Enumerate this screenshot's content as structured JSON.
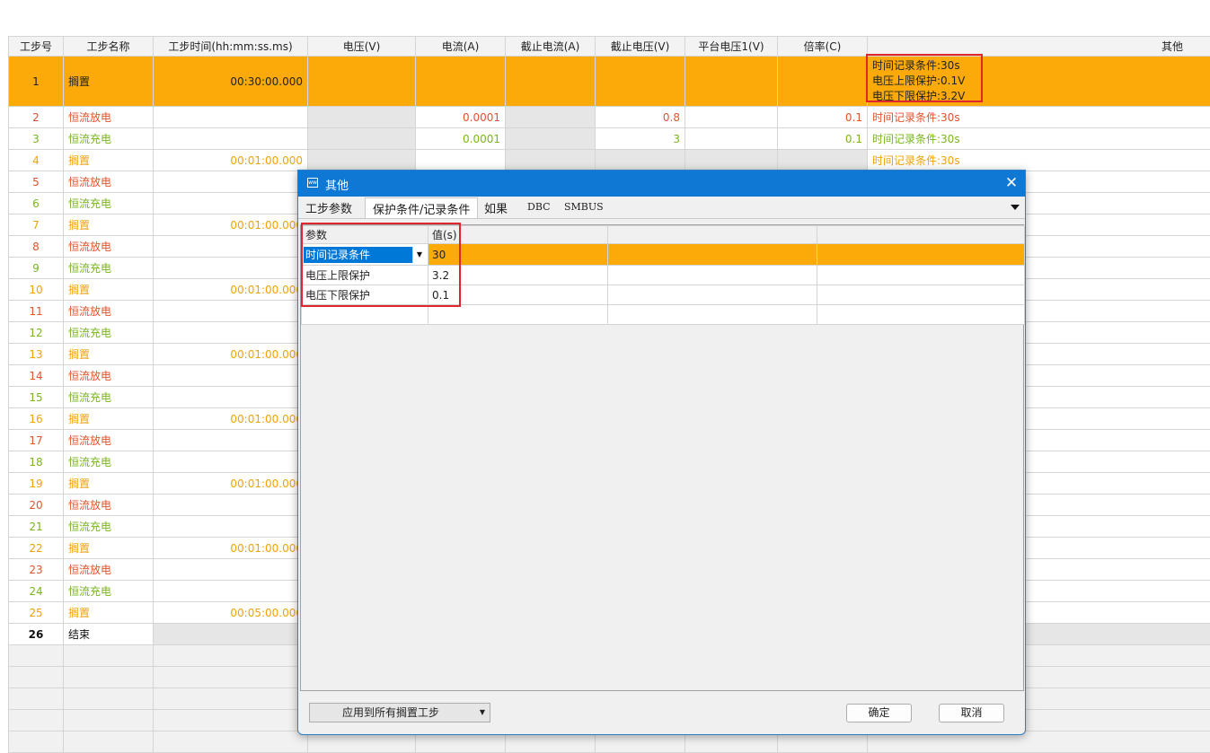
{
  "headers": [
    "工步号",
    "工步名称",
    "工步时间(hh:mm:ss.ms)",
    "电压(V)",
    "电流(A)",
    "截止电流(A)",
    "截止电压(V)",
    "平台电压1(V)",
    "倍率(C)",
    "其他"
  ],
  "steps": [
    {
      "no": "1",
      "name": "搁置",
      "time": "00:30:00.000",
      "voltage": "",
      "current": "",
      "cut_current": "",
      "cut_voltage": "",
      "plat_voltage": "",
      "rate": "",
      "other": [
        "时间记录条件:30s",
        "电压上限保护:0.1V",
        "电压下限保护:3.2V"
      ]
    },
    {
      "no": "2",
      "name": "恒流放电",
      "time": "",
      "voltage": "",
      "current": "0.0001",
      "cut_current": "",
      "cut_voltage": "0.8",
      "plat_voltage": "",
      "rate": "0.1",
      "other": [
        "时间记录条件:30s"
      ]
    },
    {
      "no": "3",
      "name": "恒流充电",
      "time": "",
      "voltage": "",
      "current": "0.0001",
      "cut_current": "",
      "cut_voltage": "3",
      "plat_voltage": "",
      "rate": "0.1",
      "other": [
        "时间记录条件:30s"
      ]
    },
    {
      "no": "4",
      "name": "搁置",
      "time": "00:01:00.000",
      "voltage": "",
      "current": "",
      "cut_current": "",
      "cut_voltage": "",
      "plat_voltage": "",
      "rate": "",
      "other": [
        "时间记录条件:30s"
      ]
    },
    {
      "no": "5",
      "name": "恒流放电",
      "time": ""
    },
    {
      "no": "6",
      "name": "恒流充电",
      "time": ""
    },
    {
      "no": "7",
      "name": "搁置",
      "time": "00:01:00.000"
    },
    {
      "no": "8",
      "name": "恒流放电",
      "time": ""
    },
    {
      "no": "9",
      "name": "恒流充电",
      "time": ""
    },
    {
      "no": "10",
      "name": "搁置",
      "time": "00:01:00.000"
    },
    {
      "no": "11",
      "name": "恒流放电",
      "time": ""
    },
    {
      "no": "12",
      "name": "恒流充电",
      "time": ""
    },
    {
      "no": "13",
      "name": "搁置",
      "time": "00:01:00.000"
    },
    {
      "no": "14",
      "name": "恒流放电",
      "time": ""
    },
    {
      "no": "15",
      "name": "恒流充电",
      "time": ""
    },
    {
      "no": "16",
      "name": "搁置",
      "time": "00:01:00.000"
    },
    {
      "no": "17",
      "name": "恒流放电",
      "time": ""
    },
    {
      "no": "18",
      "name": "恒流充电",
      "time": ""
    },
    {
      "no": "19",
      "name": "搁置",
      "time": "00:01:00.000"
    },
    {
      "no": "20",
      "name": "恒流放电",
      "time": ""
    },
    {
      "no": "21",
      "name": "恒流充电",
      "time": ""
    },
    {
      "no": "22",
      "name": "搁置",
      "time": "00:01:00.000"
    },
    {
      "no": "23",
      "name": "恒流放电",
      "time": ""
    },
    {
      "no": "24",
      "name": "恒流充电",
      "time": ""
    },
    {
      "no": "25",
      "name": "搁置",
      "time": "00:05:00.000"
    },
    {
      "no": "26",
      "name": "结束",
      "time": ""
    }
  ],
  "colors": {
    "rest": "#f0a30a",
    "discharge": "#e2532d",
    "charge": "#7ab51d",
    "selected": "#fcaa0a",
    "highlight_border": "#e0262b",
    "titlebar": "#0f78d4"
  },
  "dialog": {
    "title": "其他",
    "icon": "window-icon",
    "tabs": [
      "工步参数",
      "保护条件/记录条件",
      "如果",
      "DBC",
      "SMBUS"
    ],
    "active_tab": "保护条件/记录条件",
    "grid": {
      "headers": [
        "参数",
        "值(s)"
      ],
      "rows": [
        {
          "param": "时间记录条件",
          "value": "30"
        },
        {
          "param": "电压上限保护",
          "value": "3.2"
        },
        {
          "param": "电压下限保护",
          "value": "0.1"
        }
      ]
    },
    "apply_select": "应用到所有搁置工步",
    "ok": "确定",
    "cancel": "取消"
  }
}
